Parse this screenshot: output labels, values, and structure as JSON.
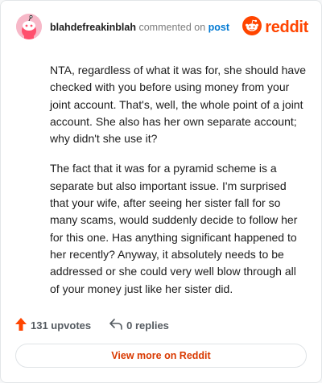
{
  "header": {
    "username": "blahdefreakinblah",
    "action_text": "commented on",
    "post_link": "post",
    "brand_name": "reddit",
    "avatar_icon": "snoo-avatar-icon",
    "brand_icon": "reddit-logo-icon"
  },
  "comment": {
    "paragraphs": [
      "NTA, regardless of what it was for, she should have checked with you before using money from your joint account. That's, well, the whole point of a joint account. She also has her own separate account; why didn't she use it?",
      "The fact that it was for a pyramid scheme is a separate but also important issue. I'm surprised that your wife, after seeing her sister fall for so many scams, would suddenly decide to follow her for this one. Has anything significant happened to her recently? Anyway, it absolutely needs to be addressed or she could very well blow through all of your money just like her sister did."
    ]
  },
  "footer": {
    "upvotes": "131 upvotes",
    "replies": "0 replies",
    "view_more": "View more on Reddit",
    "upvote_icon": "upvote-arrow-icon",
    "reply_icon": "reply-arrow-icon"
  },
  "colors": {
    "brand": "#ff4500",
    "link": "#0079d3",
    "avatar_bg": "#f7b8c8"
  }
}
